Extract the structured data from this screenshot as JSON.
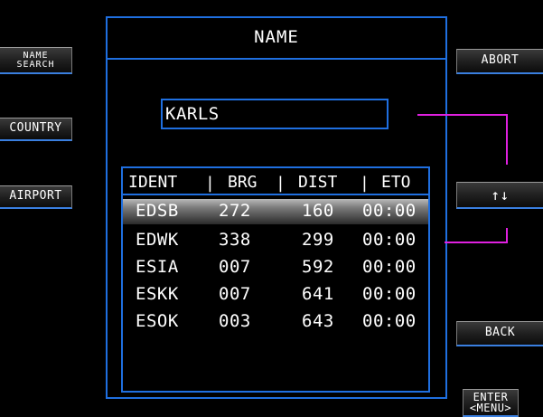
{
  "title": "NAME",
  "search_value": "KARLS",
  "left_keys": {
    "name_search_line1": "NAME",
    "name_search_line2": "SEARCH",
    "country": "COUNTRY",
    "airport": "AIRPORT"
  },
  "right_keys": {
    "abort": "ABORT",
    "scroll": "↑↓",
    "back": "BACK",
    "enter_line1": "ENTER",
    "enter_line2": "<MENU>"
  },
  "table": {
    "headers": [
      "IDENT",
      "BRG",
      "DIST",
      "ETO"
    ],
    "separator": "|",
    "rows": [
      {
        "ident": "EDSB",
        "brg": "272",
        "dist": "160",
        "eto": "00:00"
      },
      {
        "ident": "EDWK",
        "brg": "338",
        "dist": "299",
        "eto": "00:00"
      },
      {
        "ident": "ESIA",
        "brg": "007",
        "dist": "592",
        "eto": "00:00"
      },
      {
        "ident": "ESKK",
        "brg": "007",
        "dist": "641",
        "eto": "00:00"
      },
      {
        "ident": "ESOK",
        "brg": "003",
        "dist": "643",
        "eto": "00:00"
      }
    ],
    "selected_index": 0
  },
  "colors": {
    "frame": "#1f6fe0",
    "indicator": "#e020e0",
    "background": "#000000"
  }
}
